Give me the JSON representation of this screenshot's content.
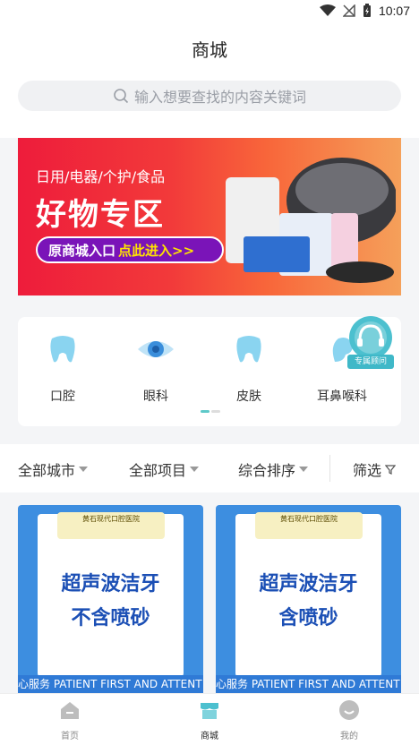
{
  "status_bar": {
    "time": "10:07"
  },
  "page": {
    "title": "商城"
  },
  "search": {
    "placeholder": "输入想要查找的内容关键词"
  },
  "banner": {
    "subtitle": "日用/电器/个护/食品",
    "title": "好物专区",
    "pill_left": "原商城入口",
    "pill_right": "点此进入>>"
  },
  "categories": [
    {
      "label": "口腔",
      "icon": "tooth-icon"
    },
    {
      "label": "眼科",
      "icon": "eye-icon"
    },
    {
      "label": "皮肤",
      "icon": "tooth-icon"
    },
    {
      "label": "耳鼻喉科",
      "icon": "ear-icon"
    }
  ],
  "consultant": {
    "label": "专属顾问"
  },
  "filters": {
    "city": "全部城市",
    "project": "全部项目",
    "sort": "综合排序",
    "screen": "筛选"
  },
  "products": [
    {
      "clinic": "黄石现代口腔医院",
      "line1": "超声波洁牙",
      "line2": "不含喷砂",
      "tag": "心服务 PATIENT FIRST AND ATTENT"
    },
    {
      "clinic": "黄石现代口腔医院",
      "line1": "超声波洁牙",
      "line2": "含喷砂",
      "tag": "心服务 PATIENT FIRST AND ATTENT"
    }
  ],
  "tabbar": {
    "home": "首页",
    "mall": "商城",
    "mine": "我的"
  },
  "colors": {
    "accent": "#5ec9c9",
    "banner_red": "#ee1c3b",
    "card_blue": "#3d8ee0"
  }
}
